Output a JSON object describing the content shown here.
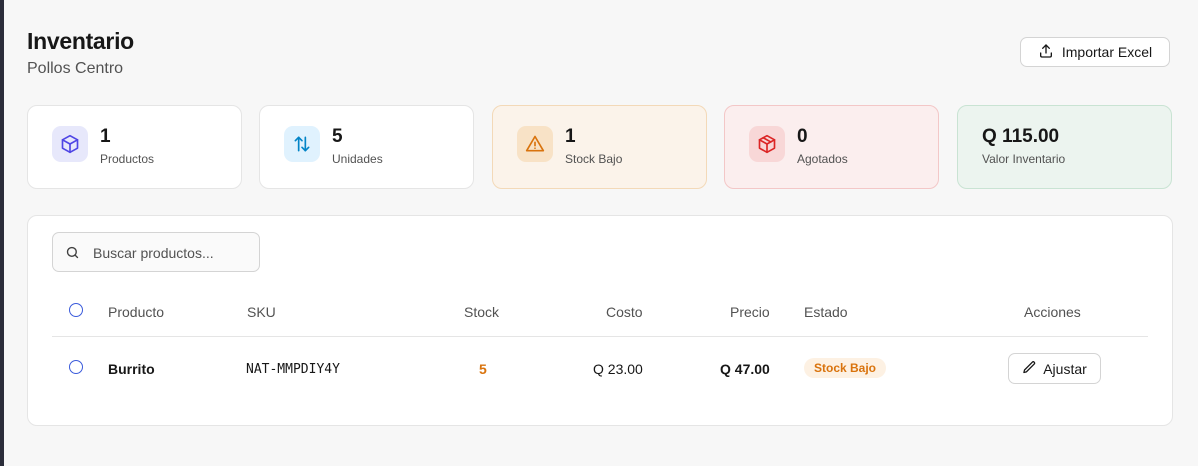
{
  "header": {
    "title": "Inventario",
    "subtitle": "Pollos Centro",
    "import_label": "Importar Excel"
  },
  "stats": [
    {
      "value": "1",
      "label": "Productos",
      "icon": "box-icon",
      "color": "#4f46e5"
    },
    {
      "value": "5",
      "label": "Unidades",
      "icon": "arrows-up-down-icon",
      "color": "#0284c7"
    },
    {
      "value": "1",
      "label": "Stock Bajo",
      "icon": "warning-icon",
      "color": "#d9730d"
    },
    {
      "value": "0",
      "label": "Agotados",
      "icon": "box-alert-icon",
      "color": "#dc2626"
    },
    {
      "value": "Q 115.00",
      "label": "Valor Inventario",
      "color": "#16a34a"
    }
  ],
  "search": {
    "placeholder": "Buscar productos..."
  },
  "table": {
    "columns": [
      "Producto",
      "SKU",
      "Stock",
      "Costo",
      "Precio",
      "Estado",
      "Acciones"
    ],
    "rows": [
      {
        "producto": "Burrito",
        "sku": "NAT-MMPDIY4Y",
        "stock": "5",
        "costo": "Q 23.00",
        "precio": "Q 47.00",
        "estado": "Stock Bajo",
        "accion": "Ajustar"
      }
    ]
  }
}
